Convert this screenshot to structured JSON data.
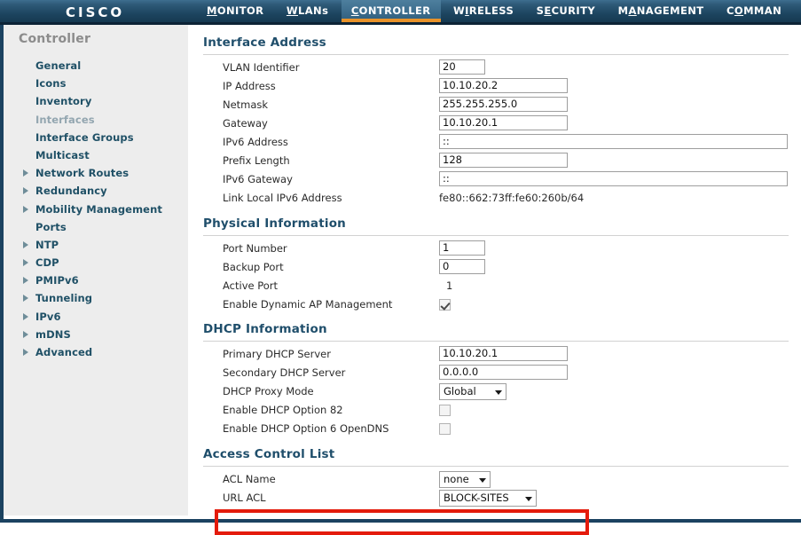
{
  "topnav": {
    "brand": "CISCO",
    "items": [
      {
        "label": "MONITOR",
        "accel_index": 0,
        "active": false
      },
      {
        "label": "WLANs",
        "accel_index": 0,
        "active": false
      },
      {
        "label": "CONTROLLER",
        "accel_index": 0,
        "active": true
      },
      {
        "label": "WIRELESS",
        "accel_index": 1,
        "active": false
      },
      {
        "label": "SECURITY",
        "accel_index": 1,
        "active": false
      },
      {
        "label": "MANAGEMENT",
        "accel_index": 1,
        "active": false
      },
      {
        "label": "COMMAN",
        "accel_index": 1,
        "active": false
      }
    ]
  },
  "sidebar": {
    "title": "Controller",
    "items": [
      {
        "label": "General",
        "expandable": false,
        "current": false
      },
      {
        "label": "Icons",
        "expandable": false,
        "current": false
      },
      {
        "label": "Inventory",
        "expandable": false,
        "current": false
      },
      {
        "label": "Interfaces",
        "expandable": false,
        "current": true
      },
      {
        "label": "Interface Groups",
        "expandable": false,
        "current": false
      },
      {
        "label": "Multicast",
        "expandable": false,
        "current": false
      },
      {
        "label": "Network Routes",
        "expandable": true,
        "current": false
      },
      {
        "label": "Redundancy",
        "expandable": true,
        "current": false
      },
      {
        "label": "Mobility Management",
        "expandable": true,
        "current": false
      },
      {
        "label": "Ports",
        "expandable": false,
        "current": false
      },
      {
        "label": "NTP",
        "expandable": true,
        "current": false
      },
      {
        "label": "CDP",
        "expandable": true,
        "current": false
      },
      {
        "label": "PMIPv6",
        "expandable": true,
        "current": false
      },
      {
        "label": "Tunneling",
        "expandable": true,
        "current": false
      },
      {
        "label": "IPv6",
        "expandable": true,
        "current": false
      },
      {
        "label": "mDNS",
        "expandable": true,
        "current": false
      },
      {
        "label": "Advanced",
        "expandable": true,
        "current": false
      }
    ]
  },
  "sections": {
    "interface_address": {
      "title": "Interface Address",
      "vlan_identifier_label": "VLAN Identifier",
      "vlan_identifier_value": "20",
      "ip_address_label": "IP Address",
      "ip_address_value": "10.10.20.2",
      "netmask_label": "Netmask",
      "netmask_value": "255.255.255.0",
      "gateway_label": "Gateway",
      "gateway_value": "10.10.20.1",
      "ipv6_address_label": "IPv6 Address",
      "ipv6_address_value": "::",
      "prefix_length_label": "Prefix Length",
      "prefix_length_value": "128",
      "ipv6_gateway_label": "IPv6 Gateway",
      "ipv6_gateway_value": "::",
      "link_local_label": "Link Local IPv6 Address",
      "link_local_value": "fe80::662:73ff:fe60:260b/64"
    },
    "physical_information": {
      "title": "Physical Information",
      "port_number_label": "Port Number",
      "port_number_value": "1",
      "backup_port_label": "Backup Port",
      "backup_port_value": "0",
      "active_port_label": "Active Port",
      "active_port_value": "1",
      "dynamic_ap_label": "Enable Dynamic AP Management",
      "dynamic_ap_checked": true
    },
    "dhcp_information": {
      "title": "DHCP Information",
      "primary_dhcp_label": "Primary DHCP Server",
      "primary_dhcp_value": "10.10.20.1",
      "secondary_dhcp_label": "Secondary DHCP Server",
      "secondary_dhcp_value": "0.0.0.0",
      "proxy_mode_label": "DHCP Proxy Mode",
      "proxy_mode_value": "Global",
      "option82_label": "Enable DHCP Option 82",
      "option82_checked": false,
      "option6_label": "Enable DHCP Option 6 OpenDNS",
      "option6_checked": false
    },
    "access_control_list": {
      "title": "Access Control List",
      "acl_name_label": "ACL Name",
      "acl_name_value": "none",
      "url_acl_label": "URL ACL",
      "url_acl_value": "BLOCK-SITES"
    }
  },
  "annotation": {
    "highlight_color": "#e41b0c",
    "highlight_target": "URL ACL"
  },
  "colors": {
    "nav_bar": "#1d4560",
    "nav_active_underline": "#e8922a",
    "sidebar_bg": "#ededed",
    "sidebar_link": "#1f5066",
    "sidebar_current": "#93a6b0",
    "section_header": "#1f4e6b",
    "frame_border": "#1b4260"
  }
}
